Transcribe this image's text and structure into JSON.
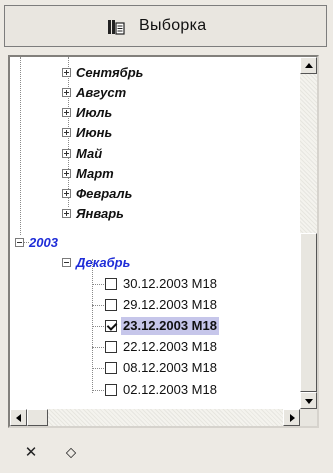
{
  "header": {
    "title": "Выборка",
    "icon": "columns-document-icon"
  },
  "tree": {
    "months_2003_collapsed": [
      "Сентябрь",
      "Август",
      "Июль",
      "Июнь",
      "Май",
      "Март",
      "Февраль",
      "Январь"
    ],
    "year": "2003",
    "expanded_month": "Декабрь",
    "files": [
      {
        "label": "30.12.2003 M18",
        "checked": false,
        "selected": false
      },
      {
        "label": "29.12.2003 M18",
        "checked": false,
        "selected": false
      },
      {
        "label": "23.12.2003 M18",
        "checked": true,
        "selected": true
      },
      {
        "label": "22.12.2003 M18",
        "checked": false,
        "selected": false
      },
      {
        "label": "08.12.2003 M18",
        "checked": false,
        "selected": false
      },
      {
        "label": "02.12.2003 M18",
        "checked": false,
        "selected": false
      }
    ]
  },
  "toolbar": {
    "clear_icon": "close-x-icon",
    "sort_icon": "up-down-chevron-icon",
    "clear_glyph": "✕",
    "sort_glyph": "⬦"
  },
  "colors": {
    "accent": "#1f2dd8",
    "selection": "#c6c6ea"
  }
}
